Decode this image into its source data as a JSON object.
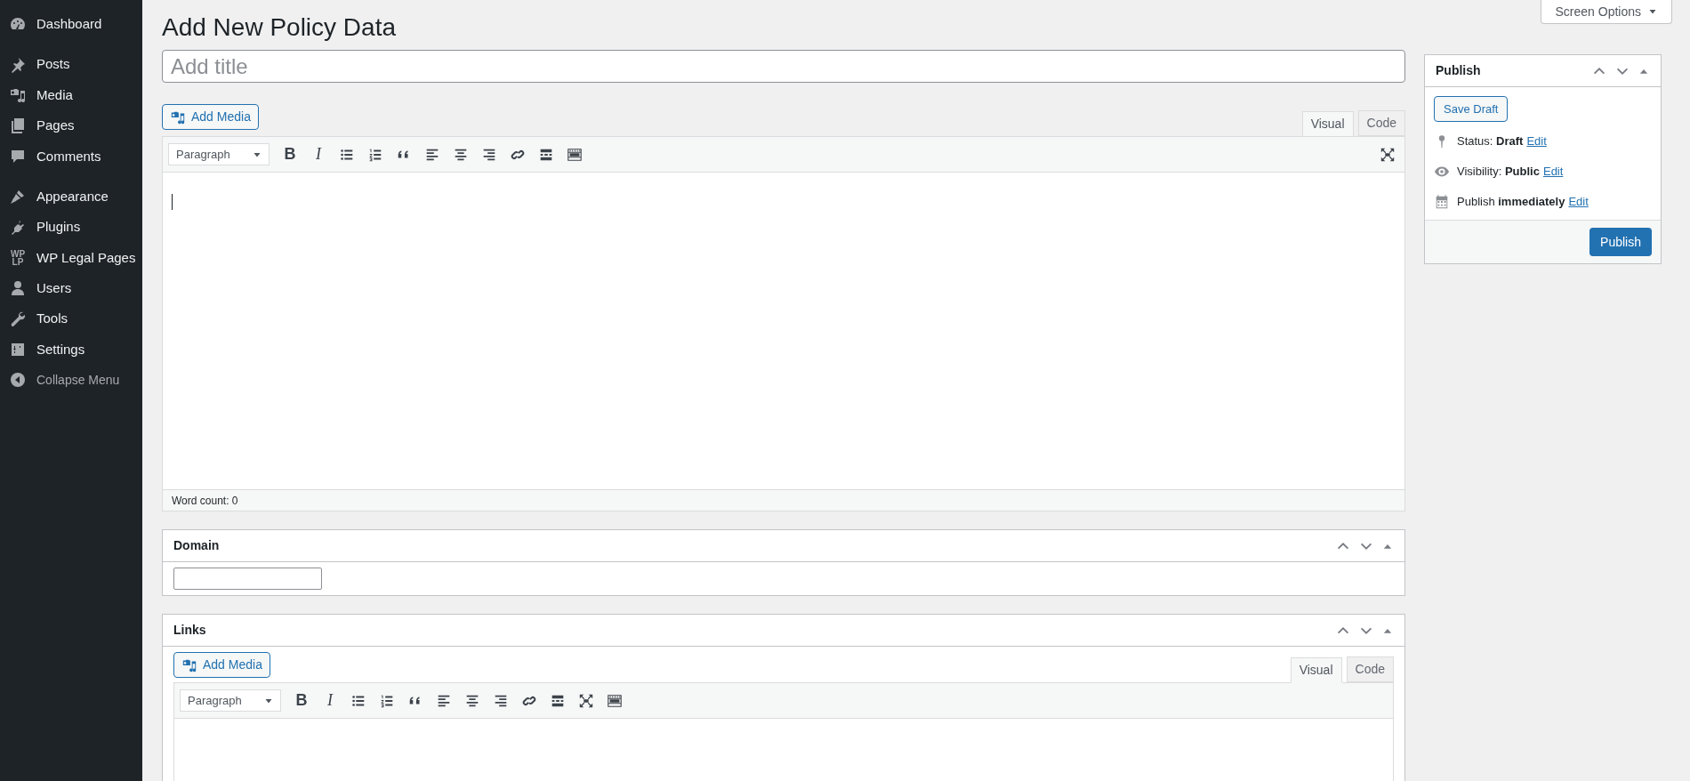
{
  "sidebar": {
    "groups": [
      [
        {
          "label": "Dashboard"
        }
      ],
      [
        {
          "label": "Posts"
        },
        {
          "label": "Media"
        },
        {
          "label": "Pages"
        },
        {
          "label": "Comments"
        }
      ],
      [
        {
          "label": "Appearance"
        },
        {
          "label": "Plugins"
        },
        {
          "label": "WP Legal Pages",
          "icon_text": [
            "WP",
            "LP"
          ]
        },
        {
          "label": "Users"
        },
        {
          "label": "Tools"
        },
        {
          "label": "Settings"
        }
      ]
    ],
    "collapse": "Collapse Menu"
  },
  "screen_options": "Screen Options",
  "page_title": "Add New Policy Data",
  "title_field": {
    "placeholder": "Add title"
  },
  "editor": {
    "add_media": "Add Media",
    "tabs": [
      {
        "label": "Visual",
        "selected": true
      },
      {
        "label": "Code",
        "selected": false
      }
    ],
    "format": "Paragraph",
    "toolbar": [
      {
        "kind": "bold",
        "text": "B"
      },
      {
        "kind": "italic",
        "text": "I"
      },
      {
        "kind": "bullets"
      },
      {
        "kind": "numbers"
      },
      {
        "kind": "quote"
      },
      {
        "kind": "left"
      },
      {
        "kind": "center"
      },
      {
        "kind": "right"
      },
      {
        "kind": "link"
      },
      {
        "kind": "more"
      },
      {
        "kind": "kitchen"
      },
      {
        "kind": "spacer"
      },
      {
        "kind": "fullscreen"
      }
    ],
    "word_count": "Word count: 0"
  },
  "metaboxes": [
    {
      "title": "Domain",
      "kind": "field"
    },
    {
      "title": "Links",
      "kind": "editor",
      "add_media": "Add Media",
      "tabs": [
        {
          "label": "Visual",
          "selected": true
        },
        {
          "label": "Code",
          "selected": false
        }
      ],
      "format": "Paragraph",
      "toolbar": [
        {
          "kind": "bold",
          "text": "B"
        },
        {
          "kind": "italic",
          "text": "I"
        },
        {
          "kind": "bullets"
        },
        {
          "kind": "numbers"
        },
        {
          "kind": "quote"
        },
        {
          "kind": "left"
        },
        {
          "kind": "center"
        },
        {
          "kind": "right"
        },
        {
          "kind": "link"
        },
        {
          "kind": "more"
        },
        {
          "kind": "fullscreen"
        },
        {
          "kind": "kitchen"
        }
      ]
    }
  ],
  "publish": {
    "title": "Publish",
    "save_draft": "Save Draft",
    "rows": [
      {
        "label": "Status:",
        "value": "Draft",
        "link": "Edit"
      },
      {
        "label": "Visibility:",
        "value": "Public",
        "link": "Edit"
      },
      {
        "label": "Publish",
        "value": "immediately",
        "link": "Edit"
      }
    ],
    "button": "Publish"
  }
}
